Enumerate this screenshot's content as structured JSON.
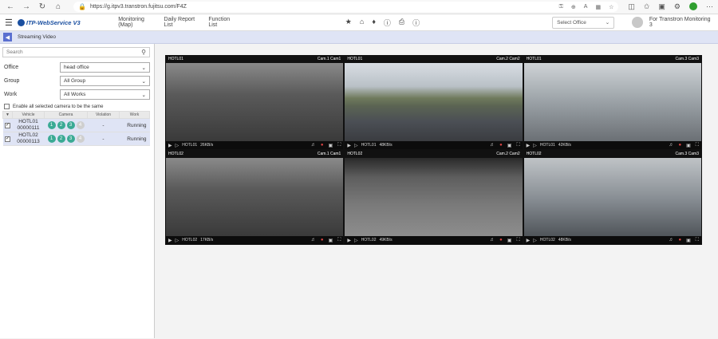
{
  "browser": {
    "url": "https://g.itpv3.transtron.fujitsu.com/F4Z"
  },
  "app": {
    "logo_text": "ITP-WebService V3",
    "menu": [
      "Monitoring (Map)",
      "Daily Report List",
      "Function List"
    ],
    "office_select": "Select Office",
    "user_name": "For Transtron Monitoring 3"
  },
  "sub_header": {
    "title": "Streaming Video"
  },
  "sidebar": {
    "search_placeholder": "Search",
    "filters": [
      {
        "label": "Office",
        "value": "head office"
      },
      {
        "label": "Group",
        "value": "All Group"
      },
      {
        "label": "Work",
        "value": "All Works"
      }
    ],
    "same_camera_label": "Enable all selected camera to be the same",
    "table_headers": [
      "Vehicle",
      "Camera",
      "Violation",
      "Work"
    ],
    "vehicles": [
      {
        "name": "HOTL01",
        "id": "00000111",
        "cams": [
          "1",
          "2",
          "3",
          "4"
        ],
        "violation": "-",
        "work": "Running"
      },
      {
        "name": "HOTL02",
        "id": "00000113",
        "cams": [
          "1",
          "2",
          "3",
          "4"
        ],
        "violation": "-",
        "work": "Running"
      }
    ]
  },
  "cameras": [
    {
      "vehicle": "HOTL01",
      "cam": "Cam.1 Cam1",
      "rate": "26KB/s"
    },
    {
      "vehicle": "HOTL01",
      "cam": "Cam.2 Cam2",
      "rate": "48KB/s"
    },
    {
      "vehicle": "HOTL01",
      "cam": "Cam.3 Cam3",
      "rate": "42KB/s"
    },
    {
      "vehicle": "HOTL02",
      "cam": "Cam.1 Cam1",
      "rate": "17KB/s"
    },
    {
      "vehicle": "HOTL02",
      "cam": "Cam.2 Cam2",
      "rate": "49KB/s"
    },
    {
      "vehicle": "HOTL02",
      "cam": "Cam.3 Cam3",
      "rate": "48KB/s"
    }
  ]
}
